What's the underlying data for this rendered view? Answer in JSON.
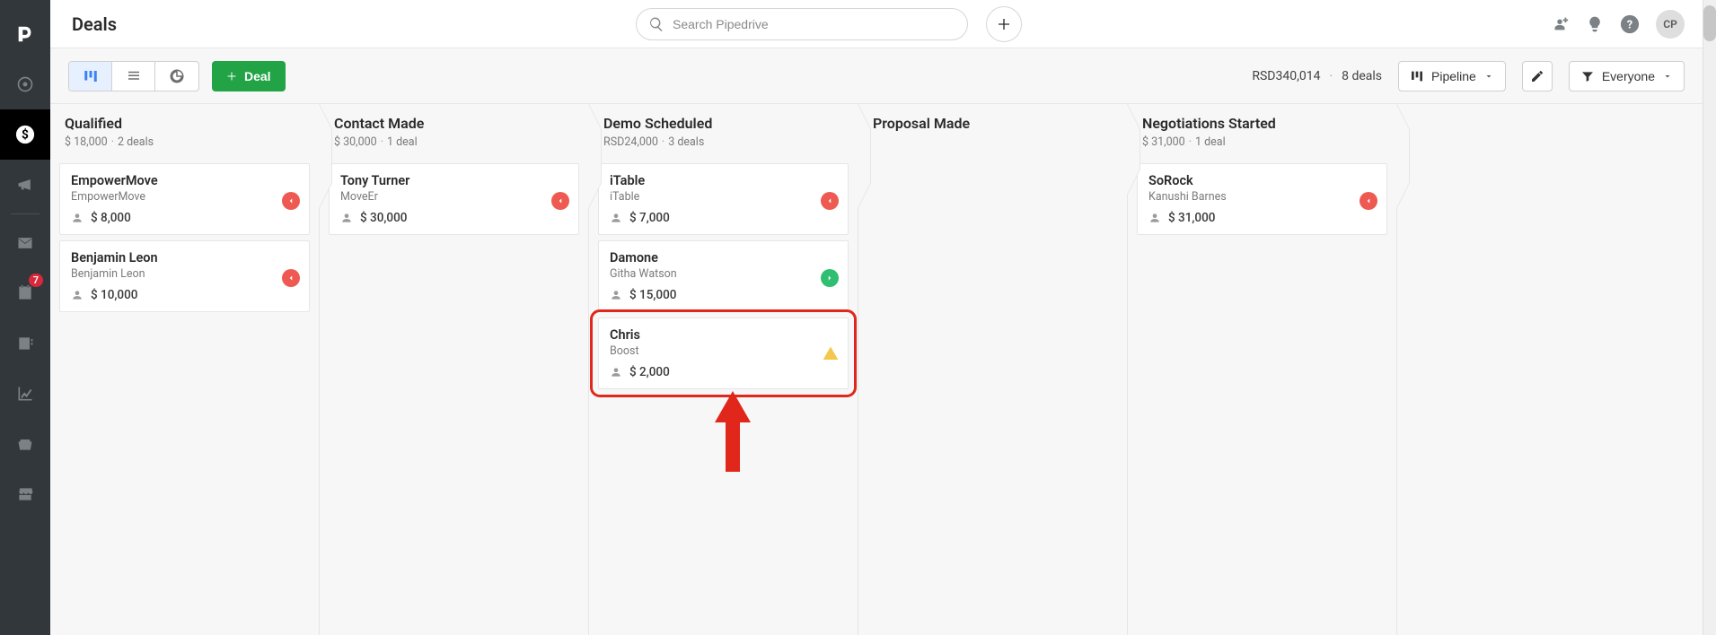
{
  "header": {
    "page_title": "Deals",
    "search_placeholder": "Search Pipedrive",
    "avatar_initials": "CP"
  },
  "rail": {
    "activities_badge": "7"
  },
  "toolbar": {
    "deal_button": "Deal",
    "summary_amount": "RSD340,014",
    "summary_count": "8 deals",
    "pipeline_label": "Pipeline",
    "filter_label": "Everyone"
  },
  "columns": [
    {
      "title": "Qualified",
      "sub_amount": "$ 18,000",
      "sub_count": "2 deals",
      "cards": [
        {
          "title": "EmpowerMove",
          "sub": "EmpowerMove",
          "amount": "$ 8,000",
          "status": "red"
        },
        {
          "title": "Benjamin Leon",
          "sub": "Benjamin Leon",
          "amount": "$ 10,000",
          "status": "red"
        }
      ]
    },
    {
      "title": "Contact Made",
      "sub_amount": "$ 30,000",
      "sub_count": "1 deal",
      "cards": [
        {
          "title": "Tony Turner",
          "sub": "MoveEr",
          "amount": "$ 30,000",
          "status": "red"
        }
      ]
    },
    {
      "title": "Demo Scheduled",
      "sub_amount": "RSD24,000",
      "sub_count": "3 deals",
      "cards": [
        {
          "title": "iTable",
          "sub": "iTable",
          "amount": "$ 7,000",
          "status": "red"
        },
        {
          "title": "Damone",
          "sub": "Githa Watson",
          "amount": "$ 15,000",
          "status": "green"
        },
        {
          "title": "Chris",
          "sub": "Boost",
          "amount": "$ 2,000",
          "status": "warn",
          "highlight": true
        }
      ]
    },
    {
      "title": "Proposal Made",
      "sub_amount": "",
      "sub_count": "",
      "cards": []
    },
    {
      "title": "Negotiations Started",
      "sub_amount": "$ 31,000",
      "sub_count": "1 deal",
      "cards": [
        {
          "title": "SoRock",
          "sub": "Kanushi Barnes",
          "amount": "$ 31,000",
          "status": "red"
        }
      ]
    }
  ]
}
